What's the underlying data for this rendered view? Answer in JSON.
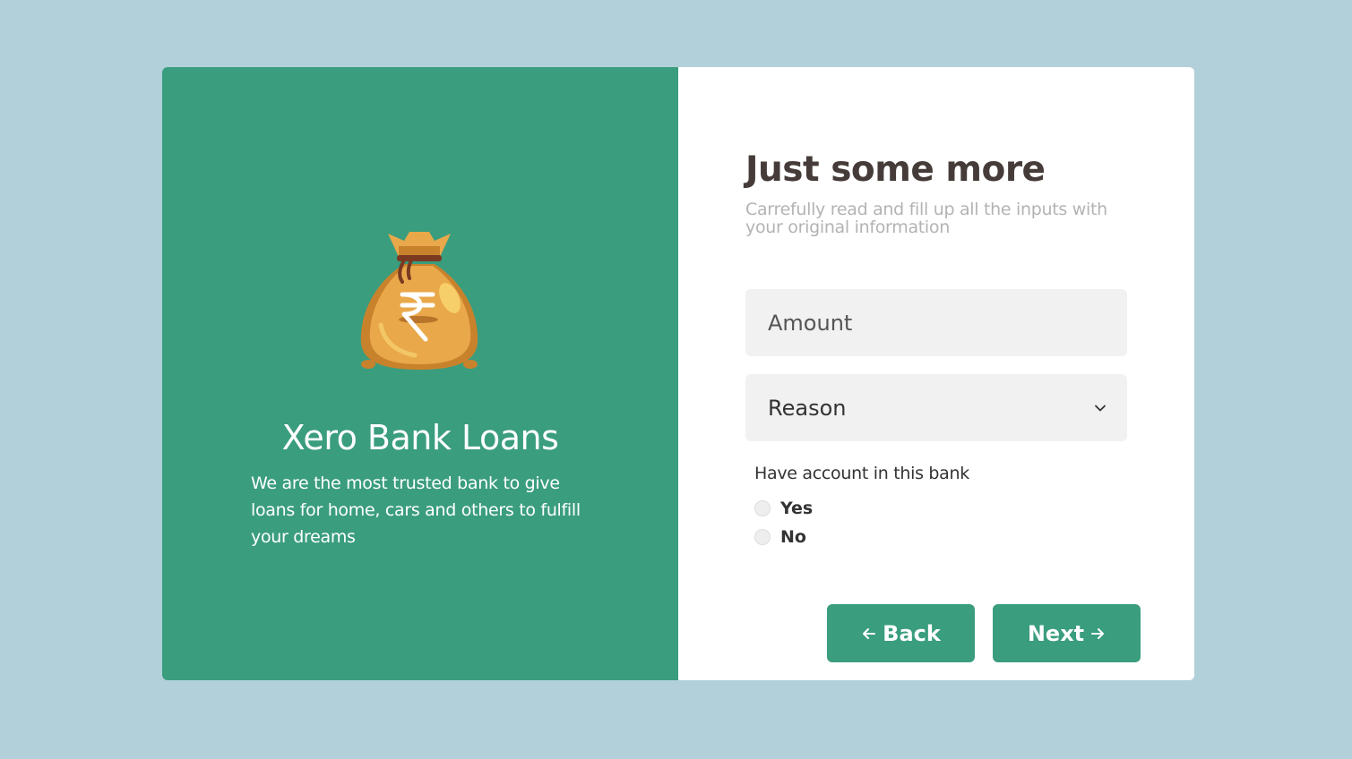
{
  "colors": {
    "background": "#b1d0d9",
    "brand": "#3a9d7e",
    "title": "#453c3a",
    "subtitle": "#b3b3b3",
    "field_bg": "#f1f1f1"
  },
  "brand_panel": {
    "icon": "money-bag-rupee-icon",
    "title": "Xero Bank Loans",
    "description": "We are the most trusted bank to give loans for home, cars and others to fulfill your dreams"
  },
  "form": {
    "title": "Just some more",
    "subtitle": "Carrefully read and fill up all the inputs with your original information",
    "amount": {
      "placeholder": "Amount",
      "value": ""
    },
    "reason": {
      "selected": "Reason",
      "icon": "chevron-down-icon"
    },
    "account_question": {
      "label": "Have account in this bank",
      "options": [
        "Yes",
        "No"
      ]
    },
    "buttons": {
      "back": "Back",
      "back_icon": "arrow-left-icon",
      "next": "Next",
      "next_icon": "arrow-right-icon"
    }
  }
}
